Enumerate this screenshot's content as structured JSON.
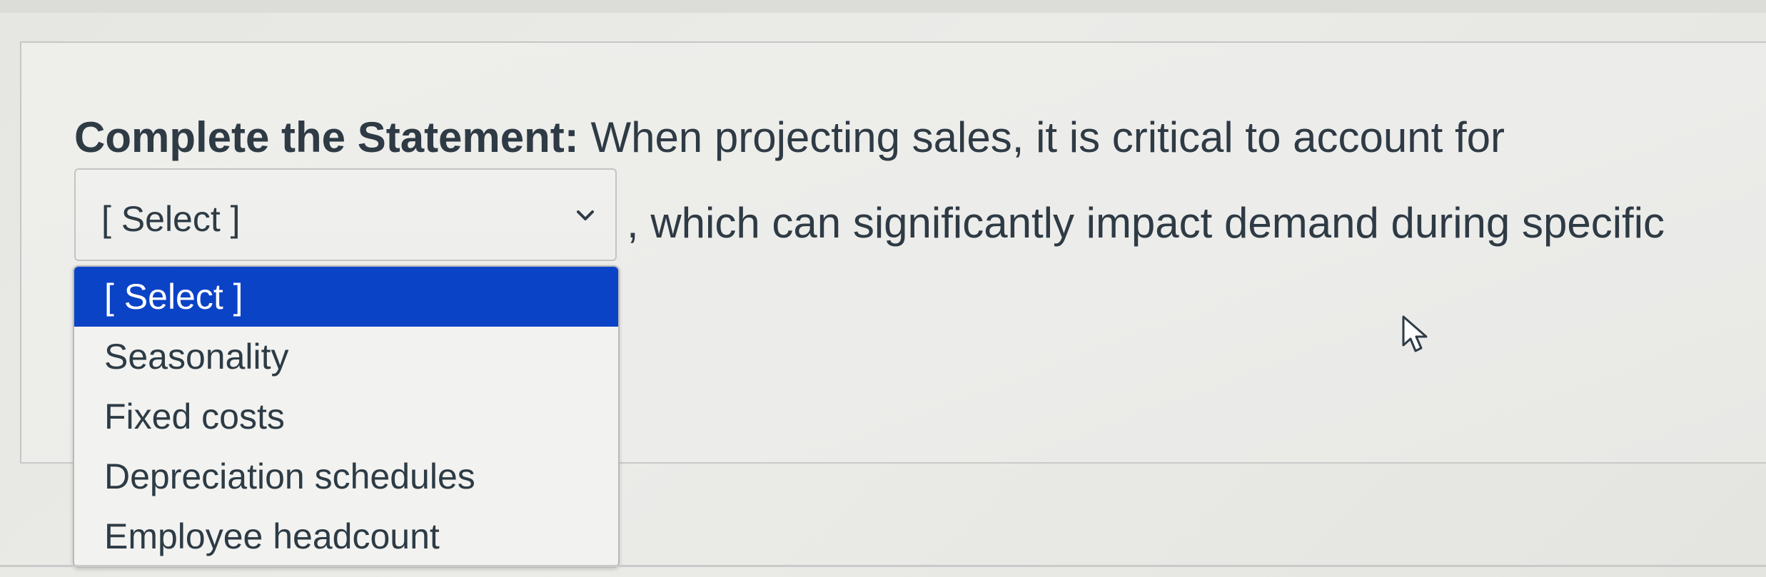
{
  "question": {
    "prompt_label": "Complete the Statement:",
    "text_before": "When projecting sales, it is critical to account for",
    "text_after": ", which can significantly impact demand during specific"
  },
  "select": {
    "current_value": "[ Select ]",
    "icons": {
      "chevron": "chevron-down-icon",
      "cursor": "mouse-pointer-icon"
    }
  },
  "dropdown": {
    "options": [
      "[ Select ]",
      "Seasonality",
      "Fixed costs",
      "Depreciation schedules",
      "Employee headcount"
    ],
    "highlighted_option": "[ Select ]"
  },
  "colors": {
    "highlight": "#0b43c7",
    "text": "#2d3b45",
    "background": "#ebebe8"
  }
}
